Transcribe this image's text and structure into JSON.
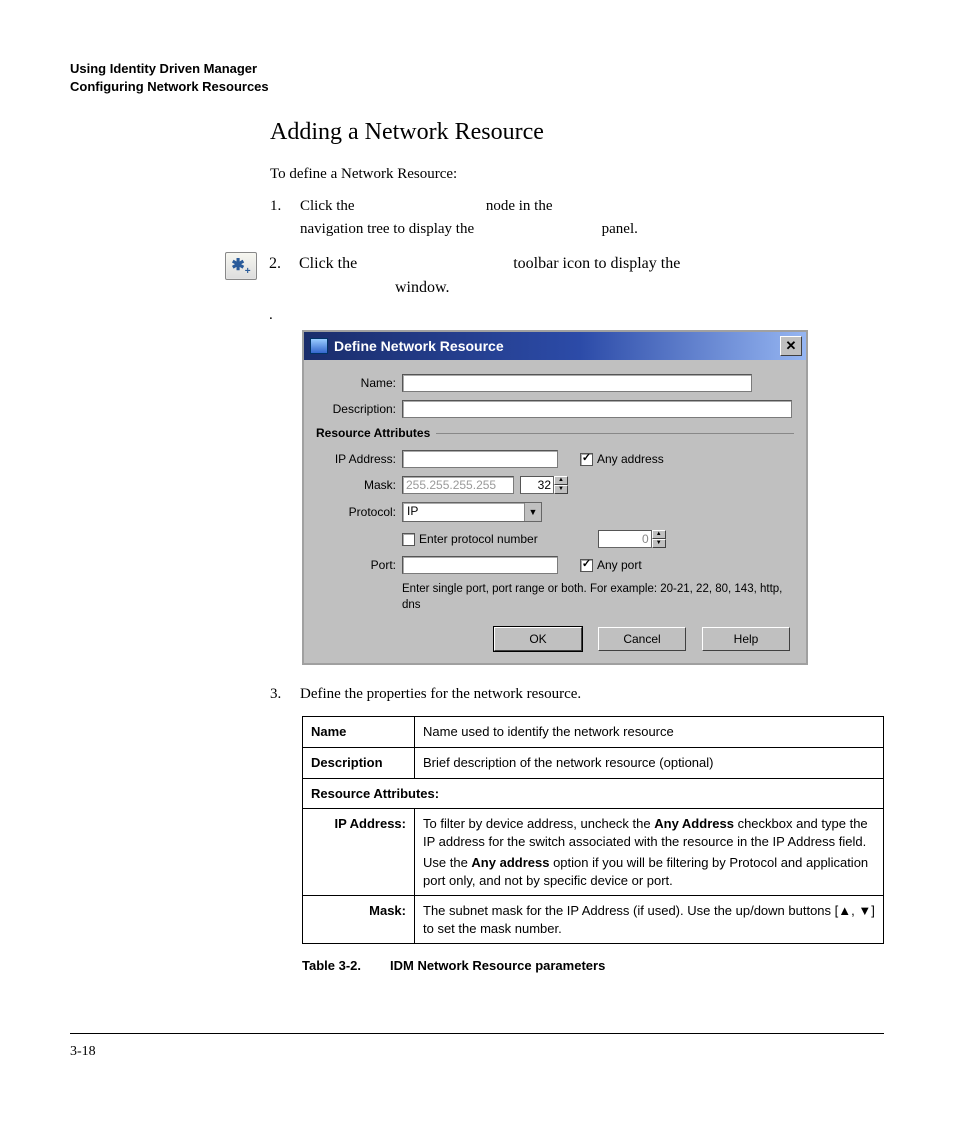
{
  "header": {
    "line1": "Using Identity Driven Manager",
    "line2": "Configuring Network Resources"
  },
  "title": "Adding a Network Resource",
  "intro": "To define a Network Resource:",
  "steps": {
    "s1": {
      "num": "1.",
      "text_a": "Click the ",
      "text_b": " node in the ",
      "text_c": "navigation tree to display the ",
      "text_d": " panel."
    },
    "s2": {
      "num": "2.",
      "text_a": "Click the ",
      "text_b": " toolbar icon to display the ",
      "text_c": " window."
    },
    "s3": {
      "num": "3.",
      "text": "Define the properties for the network resource."
    }
  },
  "dot": ".",
  "dialog": {
    "title": "Define Network Resource",
    "labels": {
      "name": "Name:",
      "description": "Description:",
      "group": "Resource Attributes",
      "ip": "IP Address:",
      "mask": "Mask:",
      "protocol": "Protocol:",
      "port": "Port:"
    },
    "values": {
      "mask_placeholder": "255.255.255.255",
      "mask_bits": "32",
      "protocol": "IP",
      "proto_num": "0"
    },
    "checkboxes": {
      "any_address": "Any address",
      "enter_proto": "Enter protocol number",
      "any_port": "Any port"
    },
    "hint": "Enter single port, port range or both. For example: 20-21, 22, 80, 143, http, dns",
    "buttons": {
      "ok": "OK",
      "cancel": "Cancel",
      "help": "Help"
    }
  },
  "table": {
    "rows": [
      {
        "name": "Name",
        "desc": "Name used to identify the network resource"
      },
      {
        "name": "Description",
        "desc": "Brief description of the network resource (optional)"
      }
    ],
    "group_header": "Resource Attributes:",
    "sub": {
      "ip_label": "IP Address:",
      "ip_p1a": "To filter by device address, uncheck the ",
      "ip_p1b": "Any Address",
      "ip_p1c": " checkbox and type the IP address for the switch associated with the resource in the IP Address field.",
      "ip_p2a": "Use the ",
      "ip_p2b": "Any address",
      "ip_p2c": " option if you will be filtering by Protocol and application port only, and not by specific device or port.",
      "mask_label": "Mask:",
      "mask_text": "The subnet mask for the IP Address (if used). Use the up/down buttons [▲, ▼] to set the mask number."
    }
  },
  "caption": {
    "num": "Table 3-2.",
    "text": "IDM Network Resource parameters"
  },
  "footer": "3-18"
}
